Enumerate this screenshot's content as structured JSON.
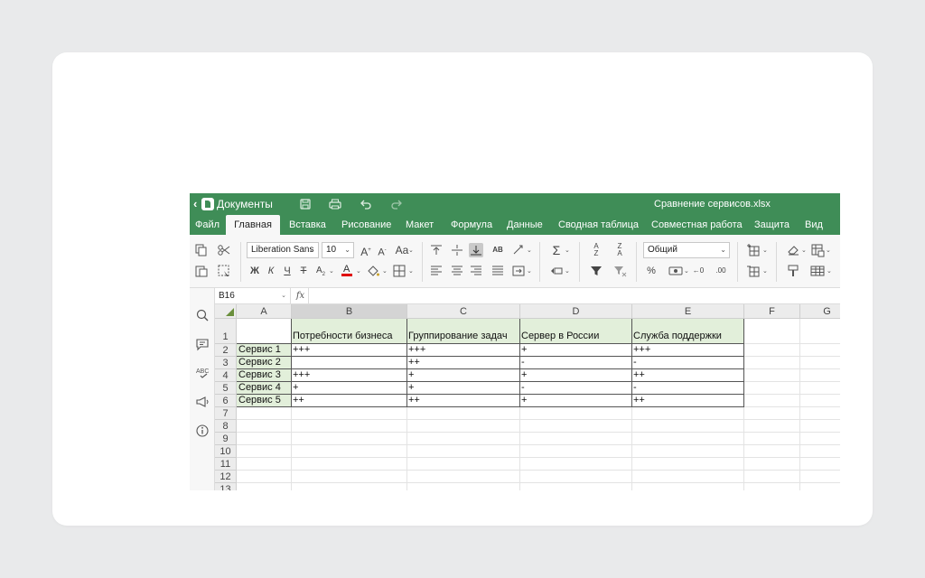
{
  "titlebar": {
    "back_label": "‹",
    "docs_label": "Документы",
    "filename": "Сравнение сервисов.xlsx"
  },
  "menu": [
    "Файл",
    "Главная",
    "Вставка",
    "Рисование",
    "Макет",
    "Формула",
    "Данные",
    "Сводная таблица",
    "Совместная работа",
    "Защита",
    "Вид"
  ],
  "menu_active_index": 1,
  "toolbar": {
    "font_name": "Liberation Sans",
    "font_size": "10",
    "number_format": "Общий",
    "bold": "Ж",
    "italic": "К",
    "underline": "Ч",
    "strike": "Т",
    "font_color_accent": "#e00000"
  },
  "formula_bar": {
    "cell_ref": "B16",
    "fx": "fx",
    "formula": ""
  },
  "grid": {
    "columns": [
      "A",
      "B",
      "C",
      "D",
      "E",
      "F",
      "G"
    ],
    "selected_column": "B",
    "rows": [
      "1",
      "2",
      "3",
      "4",
      "5",
      "6",
      "7",
      "8",
      "9",
      "10",
      "11",
      "12",
      "13"
    ],
    "header_row": [
      "",
      "Потребности бизнеса",
      "Группирование задач",
      "Сервер в России",
      "Служба поддержки"
    ],
    "data_rows": [
      [
        "Сервис 1",
        "+++",
        "+++",
        "+",
        "+++"
      ],
      [
        "Сервис 2",
        "",
        "++",
        "-",
        "-"
      ],
      [
        "Сервис 3",
        "+++",
        "+",
        "+",
        "++"
      ],
      [
        "Сервис 4",
        "+",
        "+",
        "-",
        "-"
      ],
      [
        "Сервис 5",
        "++",
        "++",
        "+",
        "++"
      ]
    ]
  },
  "colors": {
    "brand_green": "#3f8d57",
    "header_fill": "#e2efda",
    "toolbar_bg": "#f7f7f7"
  },
  "icons": {
    "titlebar": [
      "save-icon",
      "print-icon",
      "undo-icon",
      "redo-icon"
    ],
    "sidebar": [
      "search-icon",
      "comment-icon",
      "spellcheck-icon",
      "feedback-icon",
      "info-icon"
    ]
  }
}
